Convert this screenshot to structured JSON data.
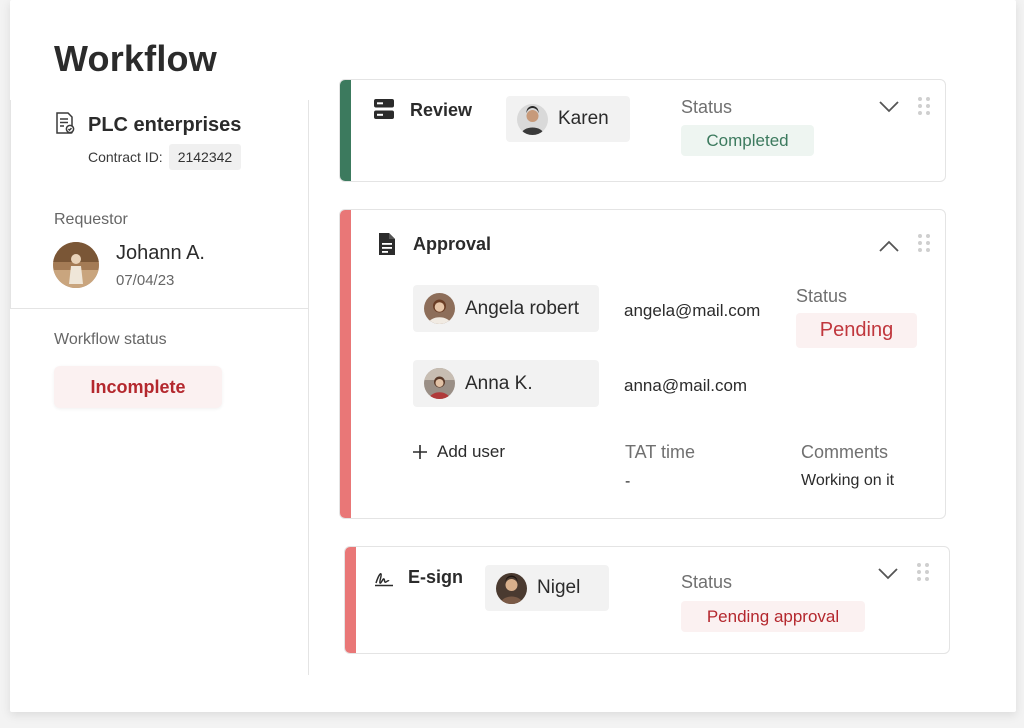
{
  "page": {
    "title": "Workflow"
  },
  "contract": {
    "company": "PLC enterprises",
    "id_label": "Contract ID:",
    "id_value": "2142342"
  },
  "requestor": {
    "label": "Requestor",
    "name": "Johann A.",
    "date": "07/04/23"
  },
  "workflow_status": {
    "label": "Workflow status",
    "value": "Incomplete",
    "color": "#b4282e"
  },
  "steps": {
    "review": {
      "title": "Review",
      "assignee": "Karen",
      "status_label": "Status",
      "status": "Completed",
      "accent": "#3c7a5e",
      "expanded": false
    },
    "approval": {
      "title": "Approval",
      "accent": "#e97777",
      "expanded": true,
      "users": [
        {
          "name": "Angela robert",
          "email": "angela@mail.com"
        },
        {
          "name": "Anna K.",
          "email": "anna@mail.com"
        }
      ],
      "status_label": "Status",
      "status": "Pending",
      "add_user": "Add user",
      "tat_label": "TAT time",
      "tat_value": "-",
      "comments_label": "Comments",
      "comments_value": "Working on it"
    },
    "esign": {
      "title": "E-sign",
      "assignee": "Nigel",
      "status_label": "Status",
      "status": "Pending approval",
      "accent": "#e97777",
      "expanded": false
    }
  },
  "icons": [
    "document-check-icon",
    "server-icon",
    "file-text-icon",
    "signature-icon",
    "chevron-down-icon",
    "chevron-up-icon",
    "drag-handle-icon",
    "plus-icon"
  ]
}
